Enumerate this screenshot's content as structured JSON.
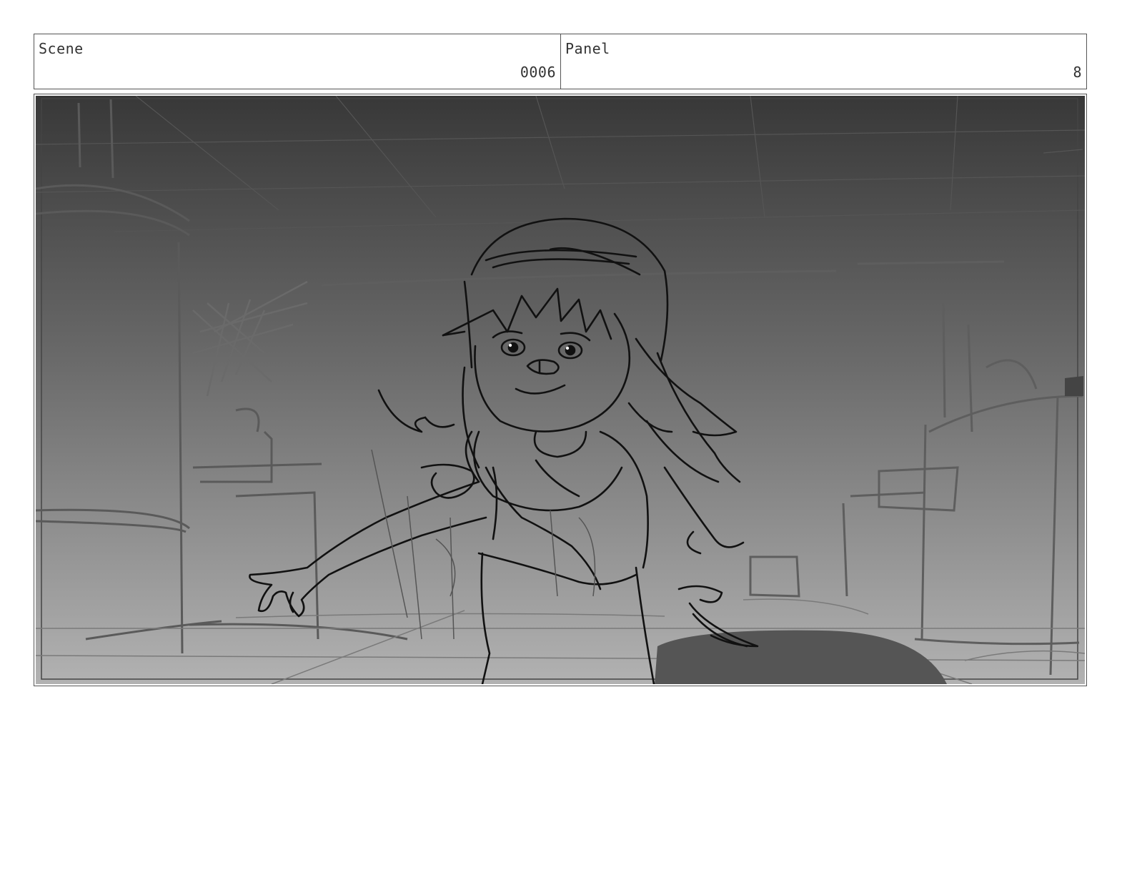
{
  "header": {
    "scene_label": "Scene",
    "scene_number": "0006",
    "panel_label": "Panel",
    "panel_number": "8"
  },
  "panel": {
    "content": "storyboard-sketch",
    "colors": {
      "bg_top": "#3a3a3a",
      "bg_bottom": "#b0b0b0",
      "ink": "#111111",
      "rough": "#6e6e6e"
    }
  }
}
